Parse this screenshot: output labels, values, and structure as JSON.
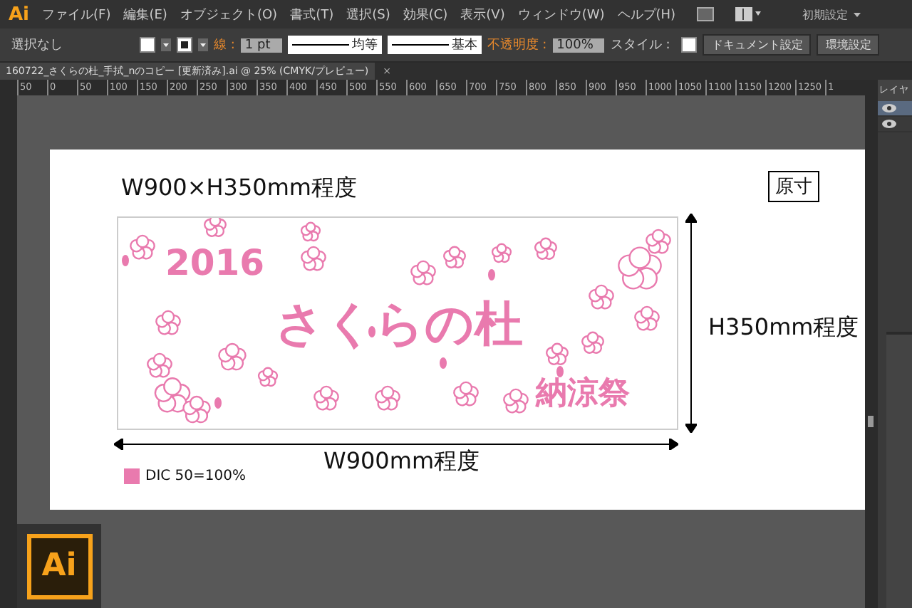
{
  "app_logo": "Ai",
  "menu": [
    "ファイル(F)",
    "編集(E)",
    "オブジェクト(O)",
    "書式(T)",
    "選択(S)",
    "効果(C)",
    "表示(V)",
    "ウィンドウ(W)",
    "ヘルプ(H)"
  ],
  "workspace": "初期設定",
  "control_bar": {
    "selection": "選択なし",
    "stroke_label": "線 :",
    "stroke_weight": "1 pt",
    "stroke_profile": "均等",
    "brush": "基本",
    "opacity_label": "不透明度 :",
    "opacity": "100%",
    "style_label": "スタイル :",
    "buttons": [
      "ドキュメント設定",
      "環境設定"
    ]
  },
  "document_tab": {
    "title": "160722_さくらの杜_手拭_nのコピー [更新済み].ai @ 25% (CMYK/プレビュー)",
    "close": "×"
  },
  "ruler": [
    "50",
    "0",
    "50",
    "100",
    "150",
    "200",
    "250",
    "300",
    "350",
    "400",
    "450",
    "500",
    "550",
    "600",
    "650",
    "700",
    "750",
    "800",
    "850",
    "900",
    "950",
    "1000",
    "1050",
    "1100",
    "1150",
    "1200",
    "1250",
    "1"
  ],
  "layers_panel": {
    "tab": "レイヤ"
  },
  "artboard": {
    "spec": "W900×H350mm程度",
    "actual_size": "原寸",
    "height_label": "H350mm程度",
    "width_label": "W900mm程度",
    "legend": "DIC 50=100%",
    "banner": {
      "year": "2016",
      "title": "さくらの杜",
      "event": "納涼祭"
    }
  },
  "badge_logo": "Ai"
}
